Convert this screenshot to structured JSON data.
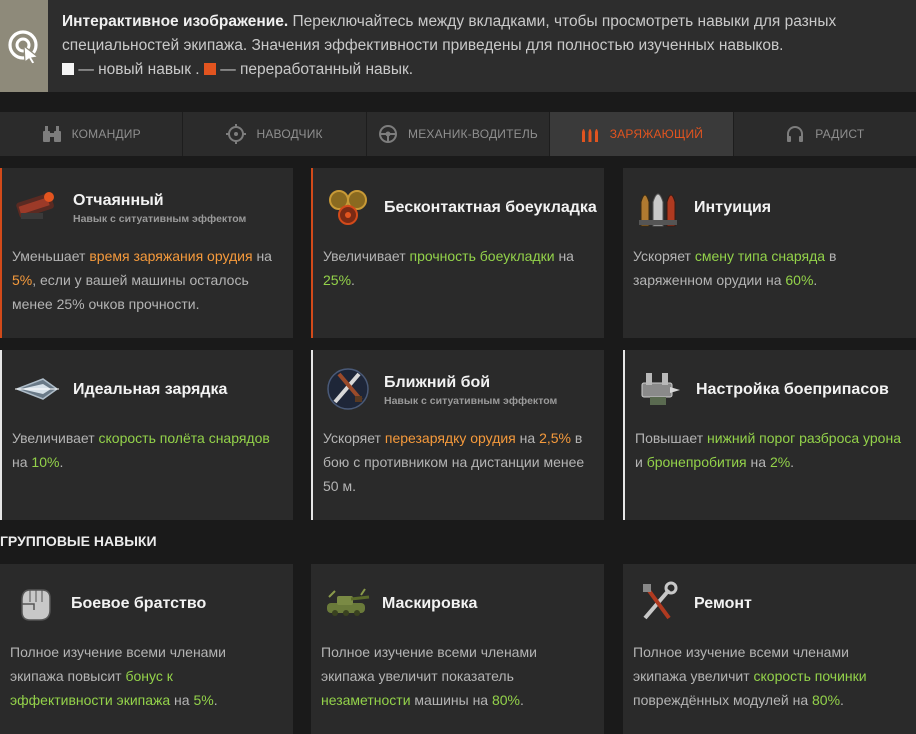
{
  "header": {
    "title": "Интерактивное изображение.",
    "text": "Переключайтесь между вкладками, чтобы просмотреть навыки для разных специальностей экипажа. Значения эффективности приведены для полностью изученных навыков.",
    "legend_new": "— новый навык .",
    "legend_reworked": "— переработанный навык."
  },
  "tabs": [
    {
      "label": "Командир",
      "icon": "binoculars-icon",
      "active": false
    },
    {
      "label": "Наводчик",
      "icon": "crosshair-icon",
      "active": false
    },
    {
      "label": "Механик-водитель",
      "icon": "steering-wheel-icon",
      "active": false
    },
    {
      "label": "Заряжающий",
      "icon": "shells-icon",
      "active": true
    },
    {
      "label": "Радист",
      "icon": "headphones-icon",
      "active": false
    }
  ],
  "skills": [
    {
      "title": "Отчаянный",
      "subtitle": "Навык с ситуативным эффектом",
      "icon": "desperate-shell-icon",
      "edge": "reworked",
      "desc": [
        "Уменьшает ",
        "время заряжания орудия",
        " на ",
        "5%",
        ", если у вашей машины осталось менее 25% очков прочности."
      ]
    },
    {
      "title": "Бесконтактная боеукладка",
      "subtitle": "",
      "icon": "ammo-rack-icon",
      "edge": "reworked",
      "desc": [
        "Увеличивает ",
        "прочность боеукладки",
        " на ",
        "25%",
        "."
      ]
    },
    {
      "title": "Интуиция",
      "subtitle": "",
      "icon": "intuition-shells-icon",
      "edge": "none",
      "desc": [
        "Ускоряет ",
        "смену типа снаряда",
        " в заряженном орудии на ",
        "60%",
        "."
      ]
    },
    {
      "title": "Идеальная зарядка",
      "subtitle": "",
      "icon": "perfect-charge-icon",
      "edge": "new",
      "desc": [
        "Увеличивает ",
        "скорость полёта снарядов",
        " на ",
        "10%",
        "."
      ]
    },
    {
      "title": "Ближний бой",
      "subtitle": "Навык с ситуативным эффектом",
      "icon": "close-combat-icon",
      "edge": "new",
      "desc": [
        "Ускоряет ",
        "перезарядку орудия",
        " на ",
        "2,5%",
        " в бою с противником на дистанции менее 50 м."
      ]
    },
    {
      "title": "Настройка боеприпасов",
      "subtitle": "",
      "icon": "ammo-tuning-icon",
      "edge": "new",
      "desc": [
        "Повышает ",
        "нижний порог разброса урона",
        " и ",
        "бронепробития",
        " на ",
        "2%",
        "."
      ]
    }
  ],
  "group_section": {
    "title": "Групповые навыки"
  },
  "group_skills": [
    {
      "title": "Боевое братство",
      "icon": "fist-icon",
      "desc": [
        "Полное изучение всеми членами экипажа повысит ",
        "бонус к эффективности экипажа",
        " на ",
        "5%",
        "."
      ]
    },
    {
      "title": "Маскировка",
      "icon": "camouflage-tank-icon",
      "desc": [
        "Полное изучение всеми членами экипажа увеличит показатель ",
        "незаметности",
        " машины на ",
        "80%",
        "."
      ]
    },
    {
      "title": "Ремонт",
      "icon": "repair-tools-icon",
      "desc": [
        "Полное изучение всеми членами экипажа увеличит ",
        "скорость починки",
        " повреждённых модулей на ",
        "80%",
        "."
      ]
    }
  ],
  "colors": {
    "accent": "#e2541f",
    "highlight_green": "#93d24a",
    "highlight_orange": "#f59a3c"
  }
}
